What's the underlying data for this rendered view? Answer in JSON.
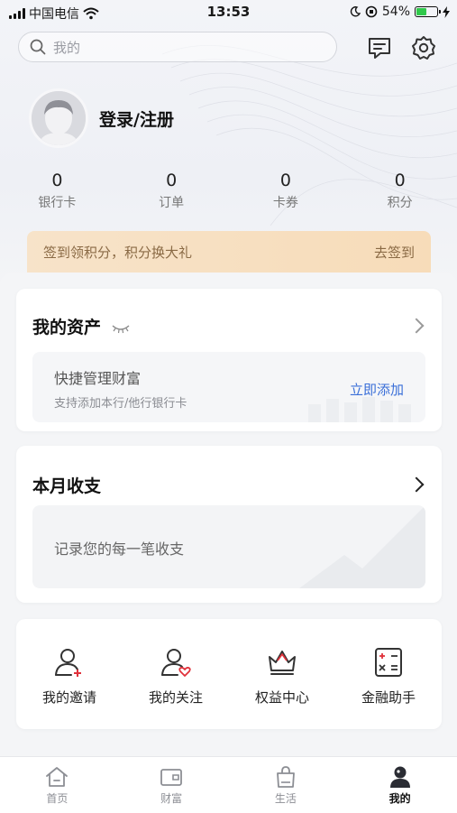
{
  "status_bar": {
    "carrier": "中国电信",
    "time": "13:53",
    "battery_percent": "54%",
    "battery_level": 0.54
  },
  "search": {
    "placeholder": "我的"
  },
  "header_icons": [
    "message-icon",
    "settings-icon"
  ],
  "profile": {
    "login_label": "登录/注册"
  },
  "stats": [
    {
      "value": "0",
      "label": "银行卡"
    },
    {
      "value": "0",
      "label": "订单"
    },
    {
      "value": "0",
      "label": "卡券"
    },
    {
      "value": "0",
      "label": "积分"
    }
  ],
  "checkin": {
    "text": "签到领积分，积分换大礼",
    "action": "去签到"
  },
  "assets": {
    "title": "我的资产",
    "box_title": "快捷管理财富",
    "box_subtitle": "支持添加本行/他行银行卡",
    "box_action": "立即添加"
  },
  "income": {
    "title": "本月收支",
    "placeholder_text": "记录您的每一笔收支"
  },
  "quick_actions": [
    {
      "label": "我的邀请",
      "icon": "invite-user-icon"
    },
    {
      "label": "我的关注",
      "icon": "follow-user-icon"
    },
    {
      "label": "权益中心",
      "icon": "crown-icon"
    },
    {
      "label": "金融助手",
      "icon": "calculator-icon"
    }
  ],
  "tabbar": {
    "items": [
      {
        "label": "首页",
        "icon": "home-icon"
      },
      {
        "label": "财富",
        "icon": "wallet-icon"
      },
      {
        "label": "生活",
        "icon": "shopping-bag-icon"
      },
      {
        "label": "我的",
        "icon": "user-icon"
      }
    ],
    "active": "我的"
  },
  "colors": {
    "accent_blue": "#3a6fd8",
    "checkin_bg": "#f7dcb9",
    "checkin_text": "#8a6a45",
    "alert_red": "#e0313b"
  }
}
